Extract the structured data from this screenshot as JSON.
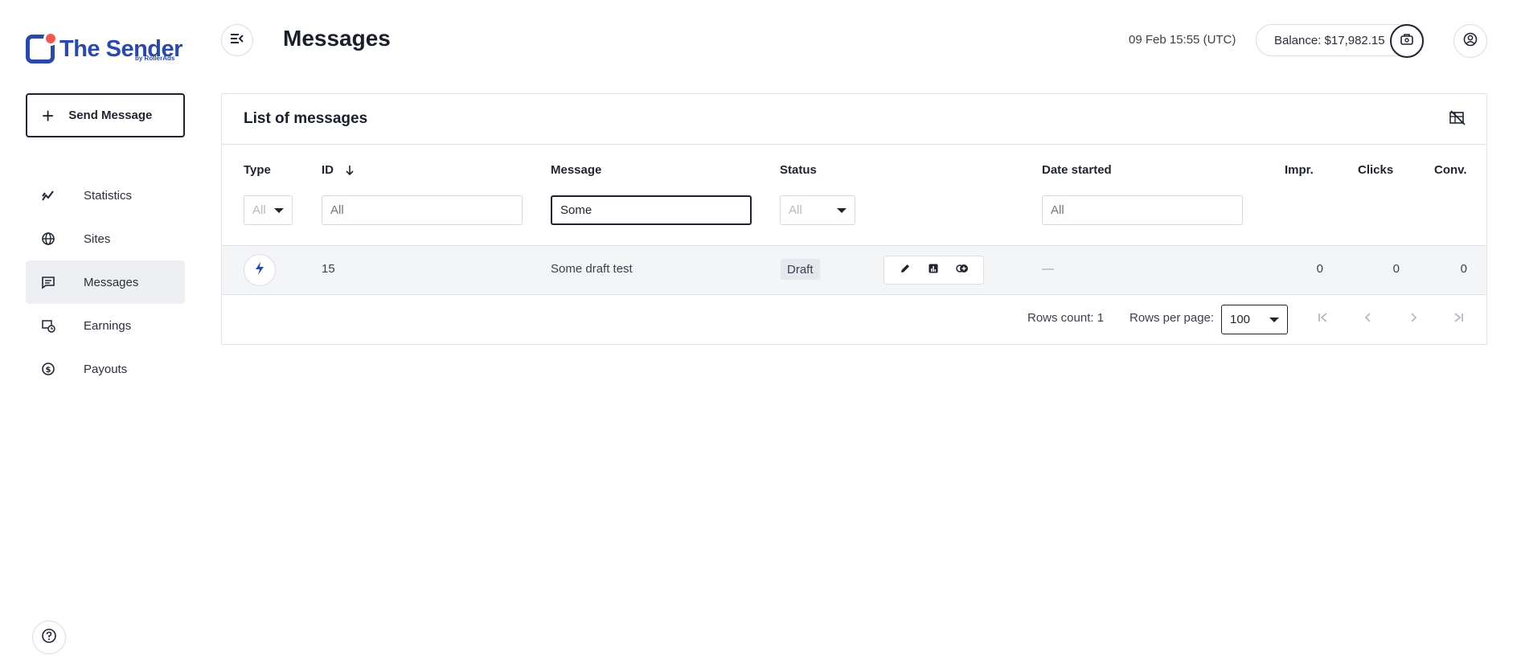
{
  "brand": {
    "name": "The Sender",
    "byline": "by RollerAds",
    "primary_color": "#2b4aa8",
    "accent_color": "#f05a4f"
  },
  "sidebar": {
    "send_button": {
      "label": "Send Message",
      "icon": "plus-icon"
    },
    "items": [
      {
        "label": "Statistics",
        "icon": "chart-line-icon",
        "active": false
      },
      {
        "label": "Sites",
        "icon": "globe-icon",
        "active": false
      },
      {
        "label": "Messages",
        "icon": "message-icon",
        "active": true
      },
      {
        "label": "Earnings",
        "icon": "money-clock-icon",
        "active": false
      },
      {
        "label": "Payouts",
        "icon": "coin-icon",
        "active": false
      }
    ],
    "help_icon": "help-icon"
  },
  "header": {
    "title": "Messages",
    "datetime": "09 Feb 15:55 (UTC)",
    "balance": "Balance: $17,982.15"
  },
  "card": {
    "title": "List of messages",
    "columns": {
      "type": "Type",
      "id": "ID",
      "message": "Message",
      "status": "Status",
      "date_started": "Date started",
      "impr": "Impr.",
      "clicks": "Clicks",
      "conv": "Conv."
    },
    "filters": {
      "type": "All",
      "id_placeholder": "All",
      "message_value": "Some",
      "status": "All",
      "date_placeholder": "All"
    },
    "rows": [
      {
        "type_icon": "lightning-icon",
        "id": "15",
        "message": "Some draft test",
        "status": "Draft",
        "date_started": "—",
        "impr": "0",
        "clicks": "0",
        "conv": "0"
      }
    ],
    "footer": {
      "rows_count": "Rows count: 1",
      "rows_per_page_label": "Rows per page:",
      "rows_per_page_value": "100"
    }
  }
}
